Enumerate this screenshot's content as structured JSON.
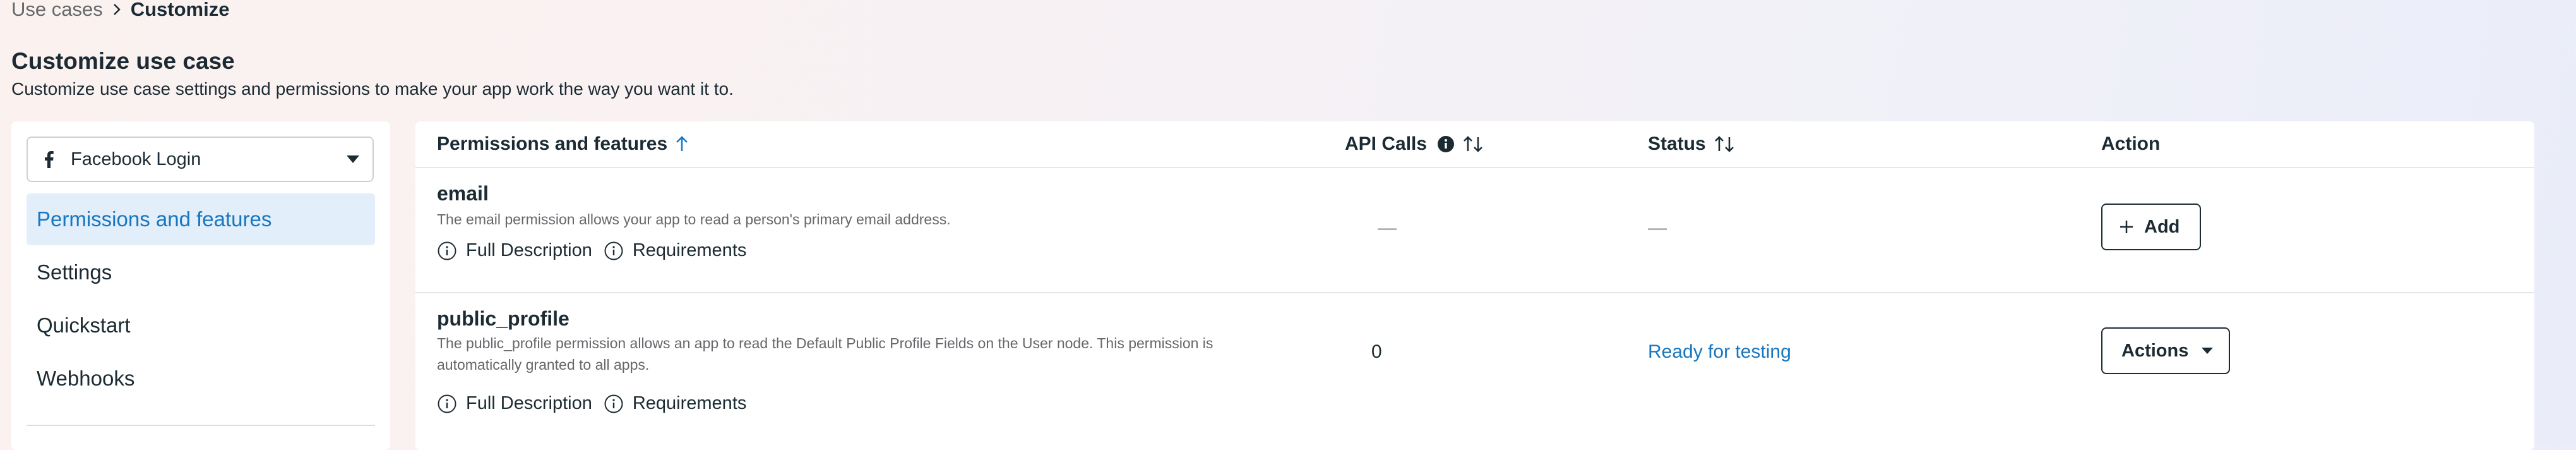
{
  "breadcrumb": {
    "parent": "Use cases",
    "current": "Customize"
  },
  "header": {
    "title": "Customize use case",
    "subtitle": "Customize use case settings and permissions to make your app work the way you want it to."
  },
  "sidebar": {
    "dropdown_label": "Facebook Login",
    "items": [
      {
        "label": "Permissions and features",
        "active": true
      },
      {
        "label": "Settings"
      },
      {
        "label": "Quickstart"
      },
      {
        "label": "Webhooks"
      }
    ]
  },
  "table": {
    "columns": {
      "permissions": "Permissions and features",
      "api_calls": "API Calls",
      "status": "Status",
      "action": "Action"
    },
    "rows": [
      {
        "name": "email",
        "description": "The email permission allows your app to read a person's primary email address.",
        "full_description": "Full Description",
        "requirements": "Requirements",
        "api_calls": "—",
        "status": "—",
        "action": "Add"
      },
      {
        "name": "public_profile",
        "description": "The public_profile permission allows an app to read the Default Public Profile Fields on the User node. This permission is automatically granted to all apps.",
        "full_description": "Full Description",
        "requirements": "Requirements",
        "api_calls": "0",
        "status": "Ready for testing",
        "action": "Actions"
      }
    ]
  },
  "colors": {
    "accent": "#1877c0",
    "active_bg": "#e2eef9",
    "text": "#1c2b33",
    "muted": "#65676b"
  },
  "icons": [
    "chevron-right-icon",
    "facebook-icon",
    "caret-down-icon",
    "sort-up-icon",
    "info-icon",
    "sort-updown-icon",
    "plus-icon",
    "info-outline-icon"
  ]
}
